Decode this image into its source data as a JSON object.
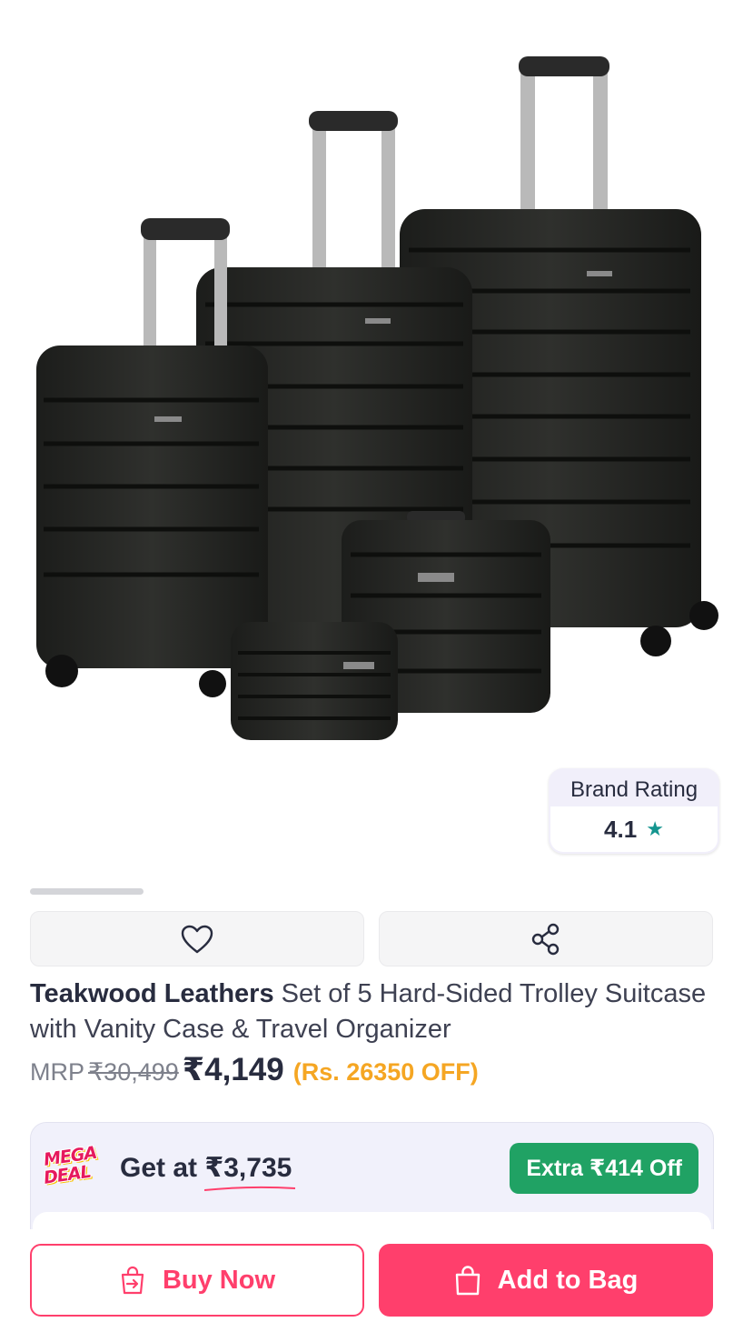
{
  "brand_rating": {
    "title": "Brand Rating",
    "value": "4.1",
    "icon": "star-icon"
  },
  "product": {
    "brand": "Teakwood Leathers",
    "name": "Set of 5 Hard-Sided Trolley Suitcase with Vanity Case & Travel Organizer",
    "mrp_label": "MRP",
    "mrp": "₹30,499",
    "price": "₹4,149",
    "discount": "(Rs. 26350 OFF)"
  },
  "actions": {
    "wishlist_icon": "heart-icon",
    "share_icon": "share-icon"
  },
  "deal": {
    "badge_line1": "MEGA",
    "badge_line2": "DEAL",
    "prefix": "Get at ",
    "price": "₹3,735",
    "extra": "Extra ₹414 Off"
  },
  "footer": {
    "buy_now": "Buy Now",
    "add_to_bag": "Add to Bag"
  },
  "colors": {
    "accent": "#ff3f6c",
    "discount": "#f5a623",
    "green": "#20a264",
    "rating_star": "#14958f"
  }
}
